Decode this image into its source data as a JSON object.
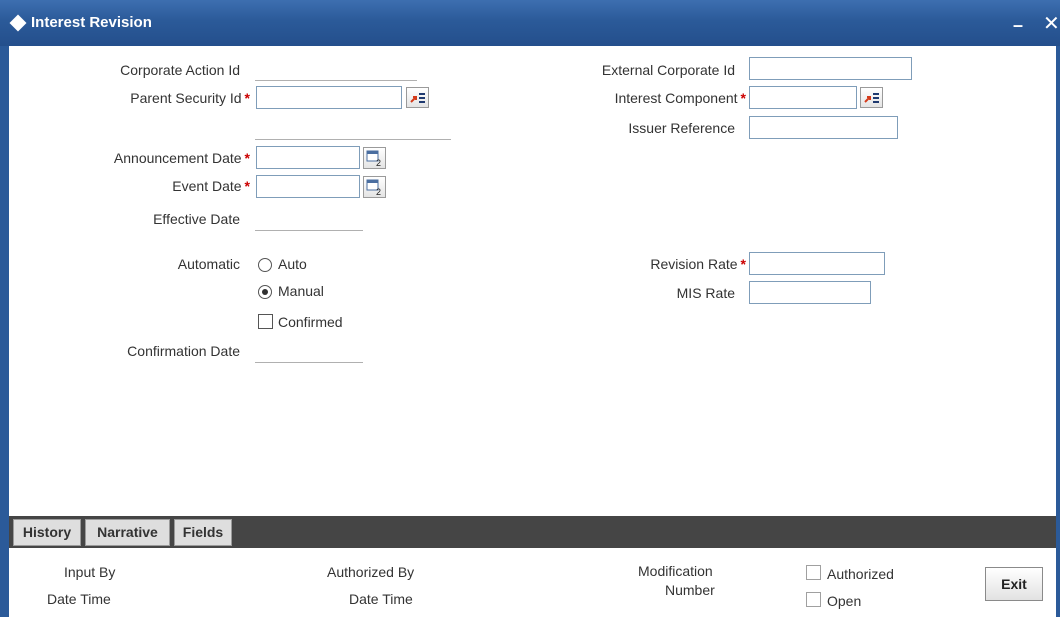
{
  "window": {
    "title": "Interest Revision",
    "minimize_glyph": "–",
    "close_glyph": "✕"
  },
  "form": {
    "corporate_action_id_label": "Corporate Action Id",
    "parent_security_id_label": "Parent Security Id",
    "announcement_date_label": "Announcement Date",
    "event_date_label": "Event Date",
    "effective_date_label": "Effective Date",
    "automatic_label": "Automatic",
    "auto_option": "Auto",
    "manual_option": "Manual",
    "confirmed_label": "Confirmed",
    "confirmation_date_label": "Confirmation Date",
    "external_corporate_id_label": "External Corporate Id",
    "interest_component_label": "Interest Component",
    "issuer_reference_label": "Issuer Reference",
    "revision_rate_label": "Revision Rate",
    "mis_rate_label": "MIS Rate",
    "required_marker": "*",
    "automatic_selected": "Manual",
    "confirmed_checked": false
  },
  "tabs": [
    "History",
    "Narrative",
    "Fields"
  ],
  "footer": {
    "input_by": "Input By",
    "date_time": "Date Time",
    "authorized_by": "Authorized By",
    "date_time_2": "Date Time",
    "modification": "Modification",
    "number": "Number",
    "authorized": "Authorized",
    "open": "Open",
    "exit": "Exit"
  },
  "colors": {
    "titlebar": "#2b5a99",
    "tabstrip": "#454545",
    "required": "#cc0000",
    "input_border": "#7f9db9"
  },
  "icons": [
    "lov-list-icon",
    "calendar-icon"
  ]
}
